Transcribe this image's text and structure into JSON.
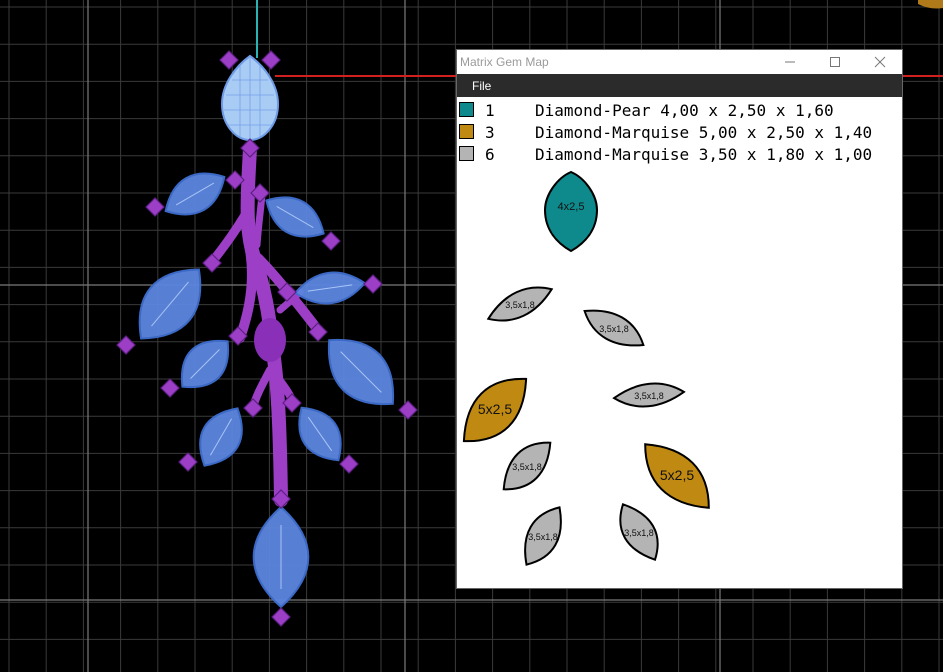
{
  "window": {
    "title": "Matrix Gem Map",
    "menu": [
      "File"
    ],
    "controls": [
      "minimize-icon",
      "maximize-icon",
      "close-icon"
    ]
  },
  "legend": [
    {
      "num": "1",
      "desc": "Diamond-Pear 4,00 x 2,50 x 1,60",
      "color": "#0e8a8c"
    },
    {
      "num": "3",
      "desc": "Diamond-Marquise 5,00 x 2,50 x 1,40",
      "color": "#c08a12"
    },
    {
      "num": "6",
      "desc": "Diamond-Marquise 3,50 x 1,80 x 1,00",
      "color": "#b4b4b4"
    }
  ],
  "gem_labels": {
    "pear": "4x2,5",
    "marquise_large": "5x2,5",
    "marquise_small": "3,5x1,8"
  },
  "colors": {
    "viewport_bg": "#000000",
    "grid_minor": "#3a3a3a",
    "grid_major": "#7a7a7a",
    "axis_red": "#d02020",
    "axis_teal": "#2ab3b3",
    "model_metal": "#9c3fc6",
    "model_stone": "#5c86e0"
  }
}
